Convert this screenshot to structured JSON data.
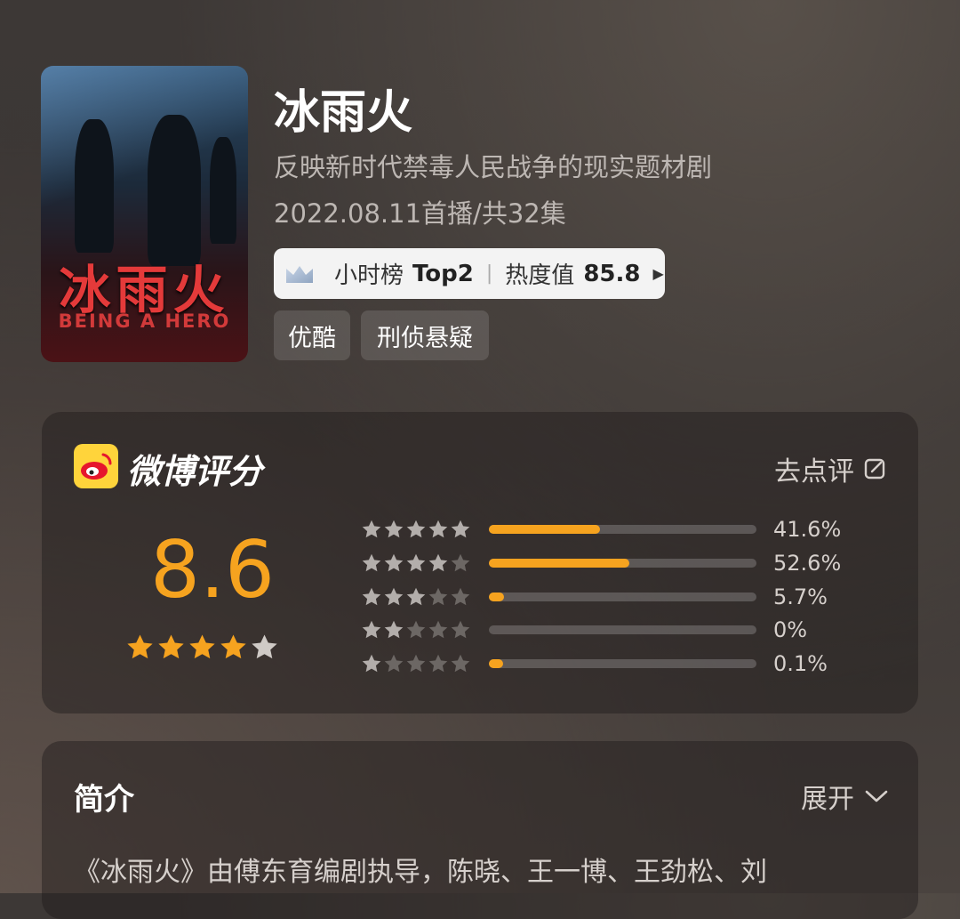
{
  "show": {
    "title": "冰雨火",
    "description": "反映新时代禁毒人民战争的现实题材剧",
    "premiere": "2022.08.11首播/共32集",
    "poster": {
      "title_cn": "冰雨火",
      "title_en": "BEING A HERO"
    }
  },
  "rank": {
    "board": "小时榜",
    "position": "Top2",
    "heat_label": "热度值",
    "heat_value": "85.8"
  },
  "tags": [
    "优酷",
    "刑侦悬疑"
  ],
  "rating": {
    "brand": "微博评分",
    "action": "去点评",
    "score": "8.6",
    "score_stars": 4,
    "distribution": [
      {
        "stars": 5,
        "percent_text": "41.6%",
        "bar_fill": 0.416
      },
      {
        "stars": 4,
        "percent_text": "52.6%",
        "bar_fill": 0.526
      },
      {
        "stars": 3,
        "percent_text": "5.7%",
        "bar_fill": 0.057
      },
      {
        "stars": 2,
        "percent_text": "0%",
        "bar_fill": 0
      },
      {
        "stars": 1,
        "percent_text": "0.1%",
        "bar_fill": 0.001
      }
    ]
  },
  "intro": {
    "title": "简介",
    "expand_label": "展开",
    "text": "《冰雨火》由傅东育编剧执导，陈晓、王一博、王劲松、刘"
  },
  "colors": {
    "accent": "#f6a31f",
    "text_muted": "#bdb7b3",
    "weibo_yellow": "#ffd43b",
    "weibo_red": "#e6162d"
  }
}
